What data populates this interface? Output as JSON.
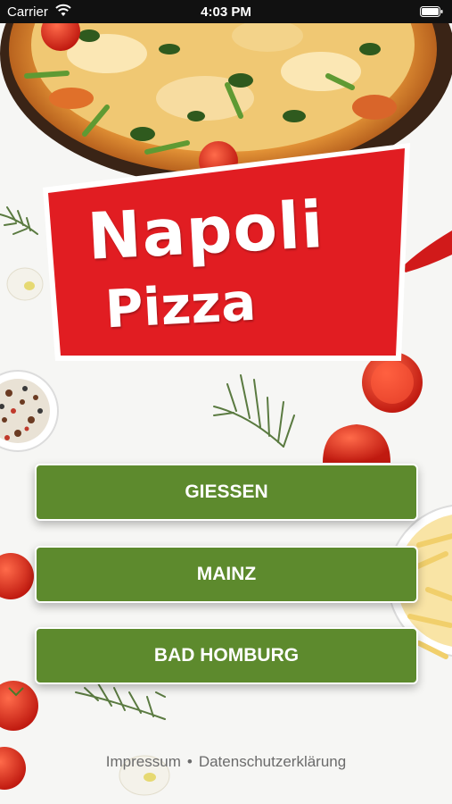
{
  "status_bar": {
    "carrier": "Carrier",
    "time": "4:03 PM",
    "icons": [
      "wifi-icon",
      "battery-icon"
    ]
  },
  "logo": {
    "line1": "Napoli",
    "line2": "Pizza",
    "background_color": "#e11d22"
  },
  "locations": [
    {
      "label": "GIESSEN"
    },
    {
      "label": "MAINZ"
    },
    {
      "label": "BAD HOMBURG"
    }
  ],
  "footer": {
    "impressum": "Impressum",
    "separator": "•",
    "privacy": "Datenschutzerklärung"
  },
  "colors": {
    "button_green": "#5d8a2d",
    "logo_red": "#e11d22",
    "footer_text": "#6b6b6b"
  }
}
